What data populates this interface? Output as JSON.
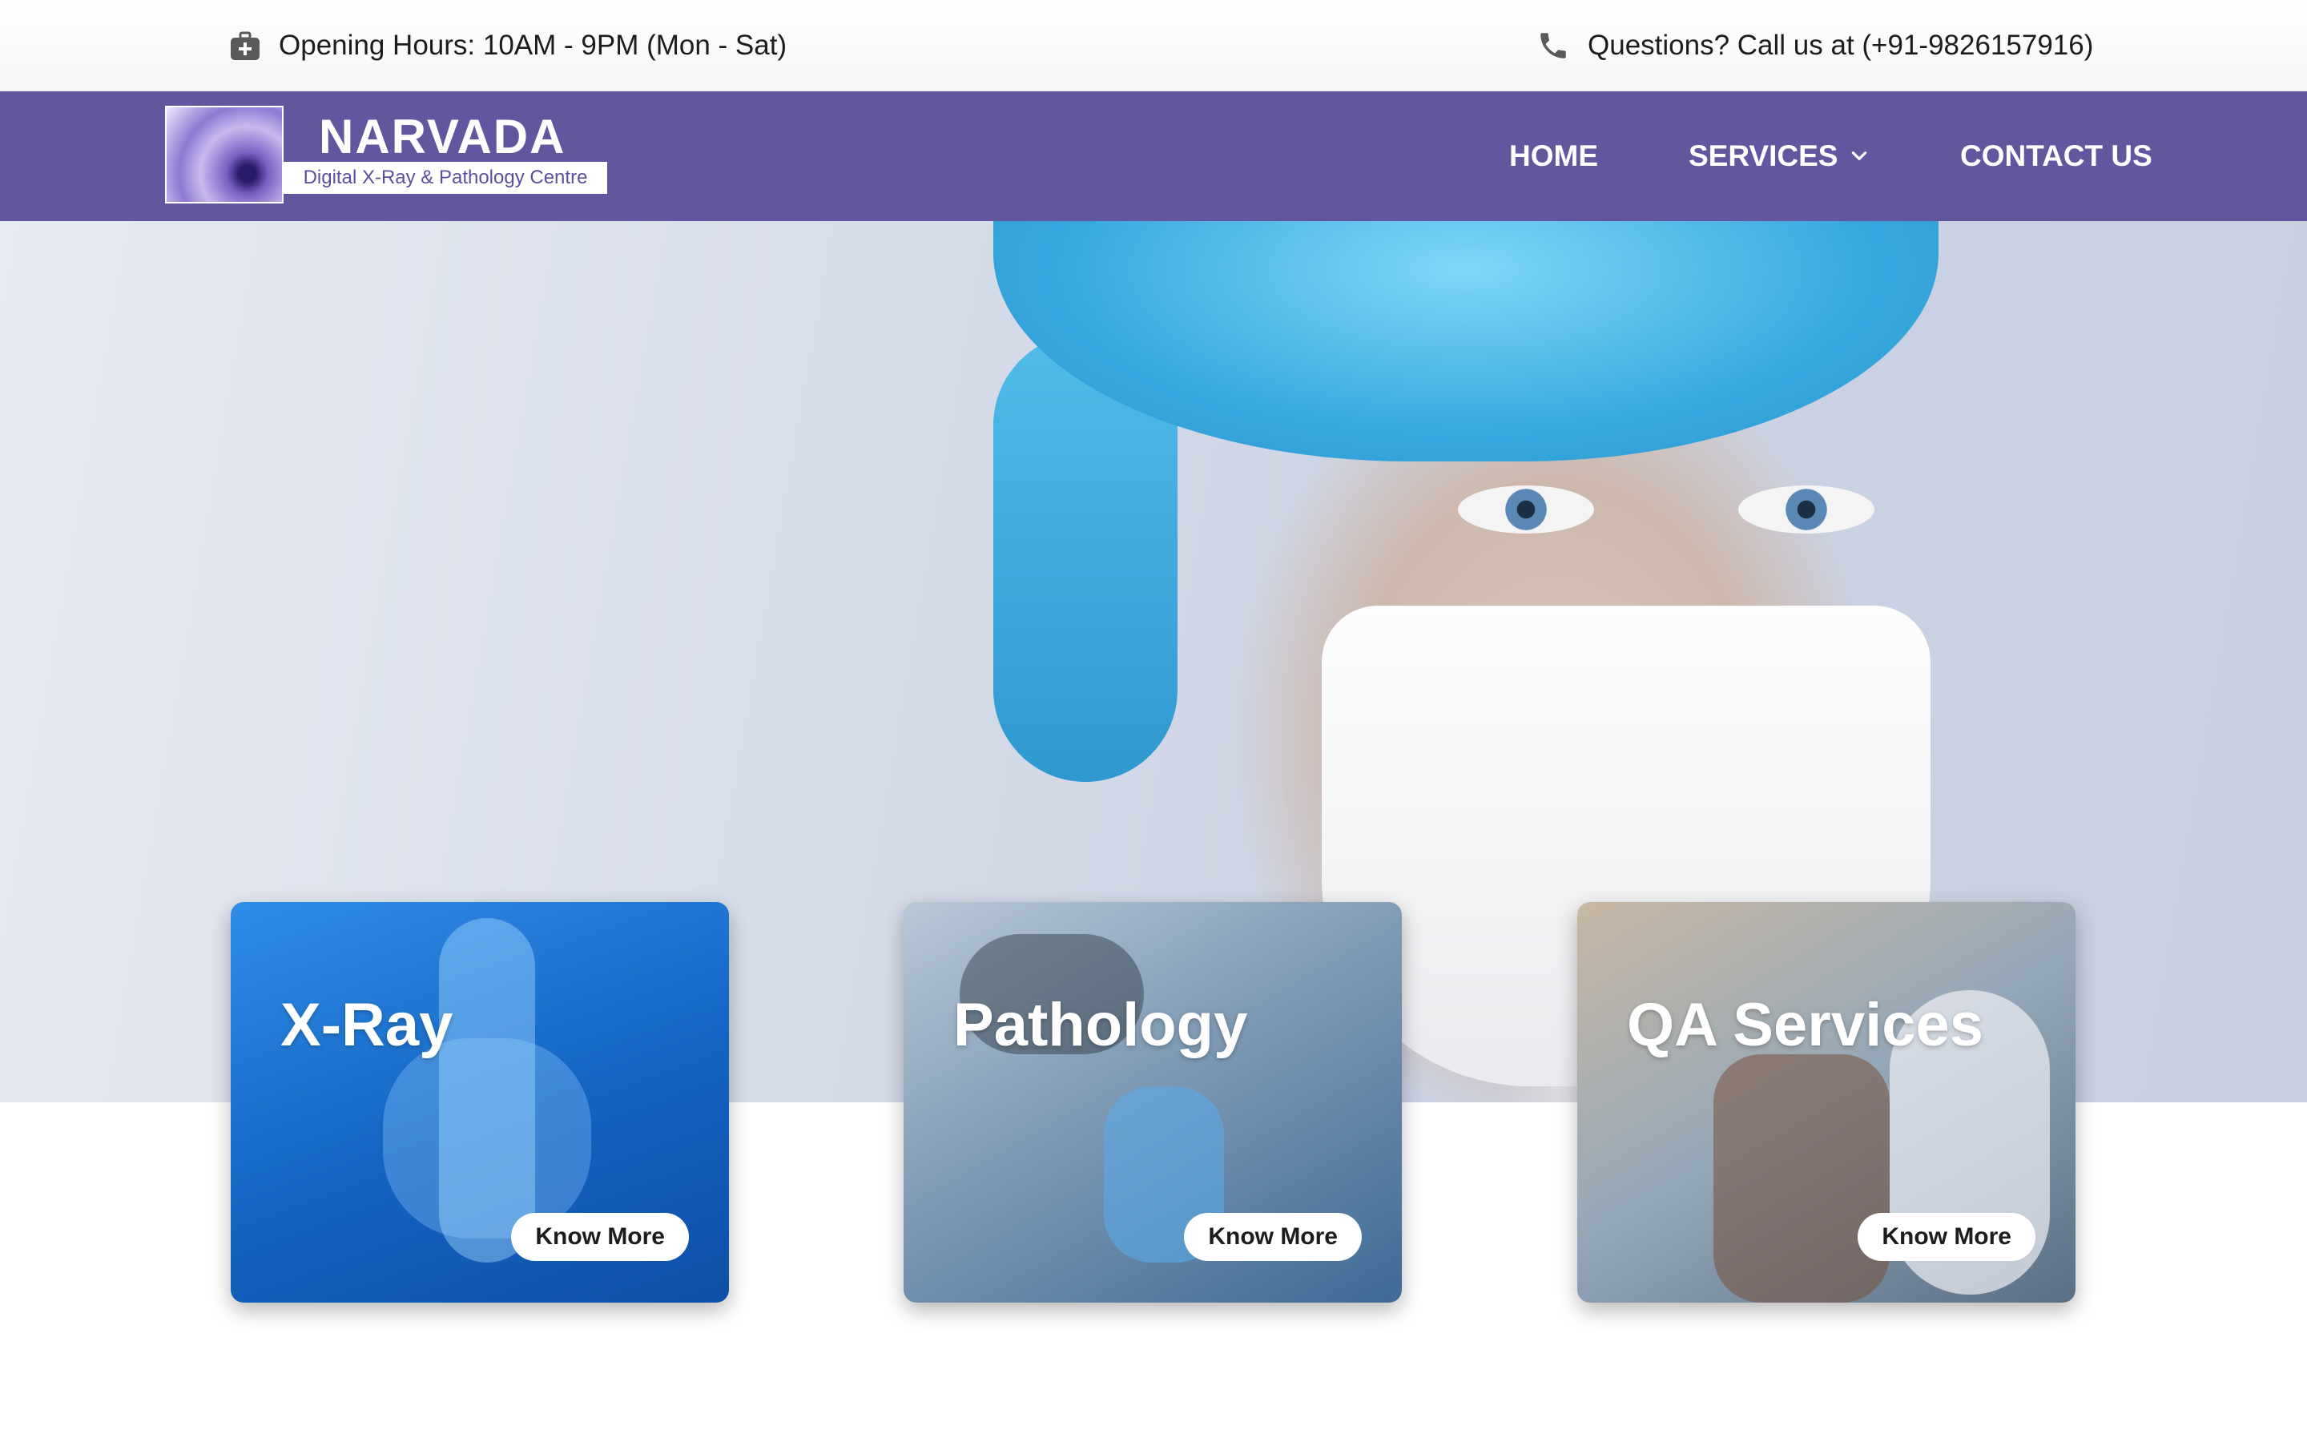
{
  "topbar": {
    "hours_icon": "first-aid-kit-icon",
    "hours_text": "Opening Hours: 10AM - 9PM (Mon - Sat)",
    "phone_icon": "phone-icon",
    "phone_text": "Questions? Call us at (+91-9826157916)"
  },
  "brand": {
    "name": "NARVADA",
    "tagline": "Digital X-Ray & Pathology Centre",
    "color": "#62569e"
  },
  "nav": {
    "home": "HOME",
    "services": "SERVICES",
    "services_icon": "chevron-down-icon",
    "contact": "CONTACT US"
  },
  "cards": [
    {
      "title": "X-Ray",
      "button": "Know More"
    },
    {
      "title": "Pathology",
      "button": "Know More"
    },
    {
      "title": "QA Services",
      "button": "Know More"
    }
  ]
}
